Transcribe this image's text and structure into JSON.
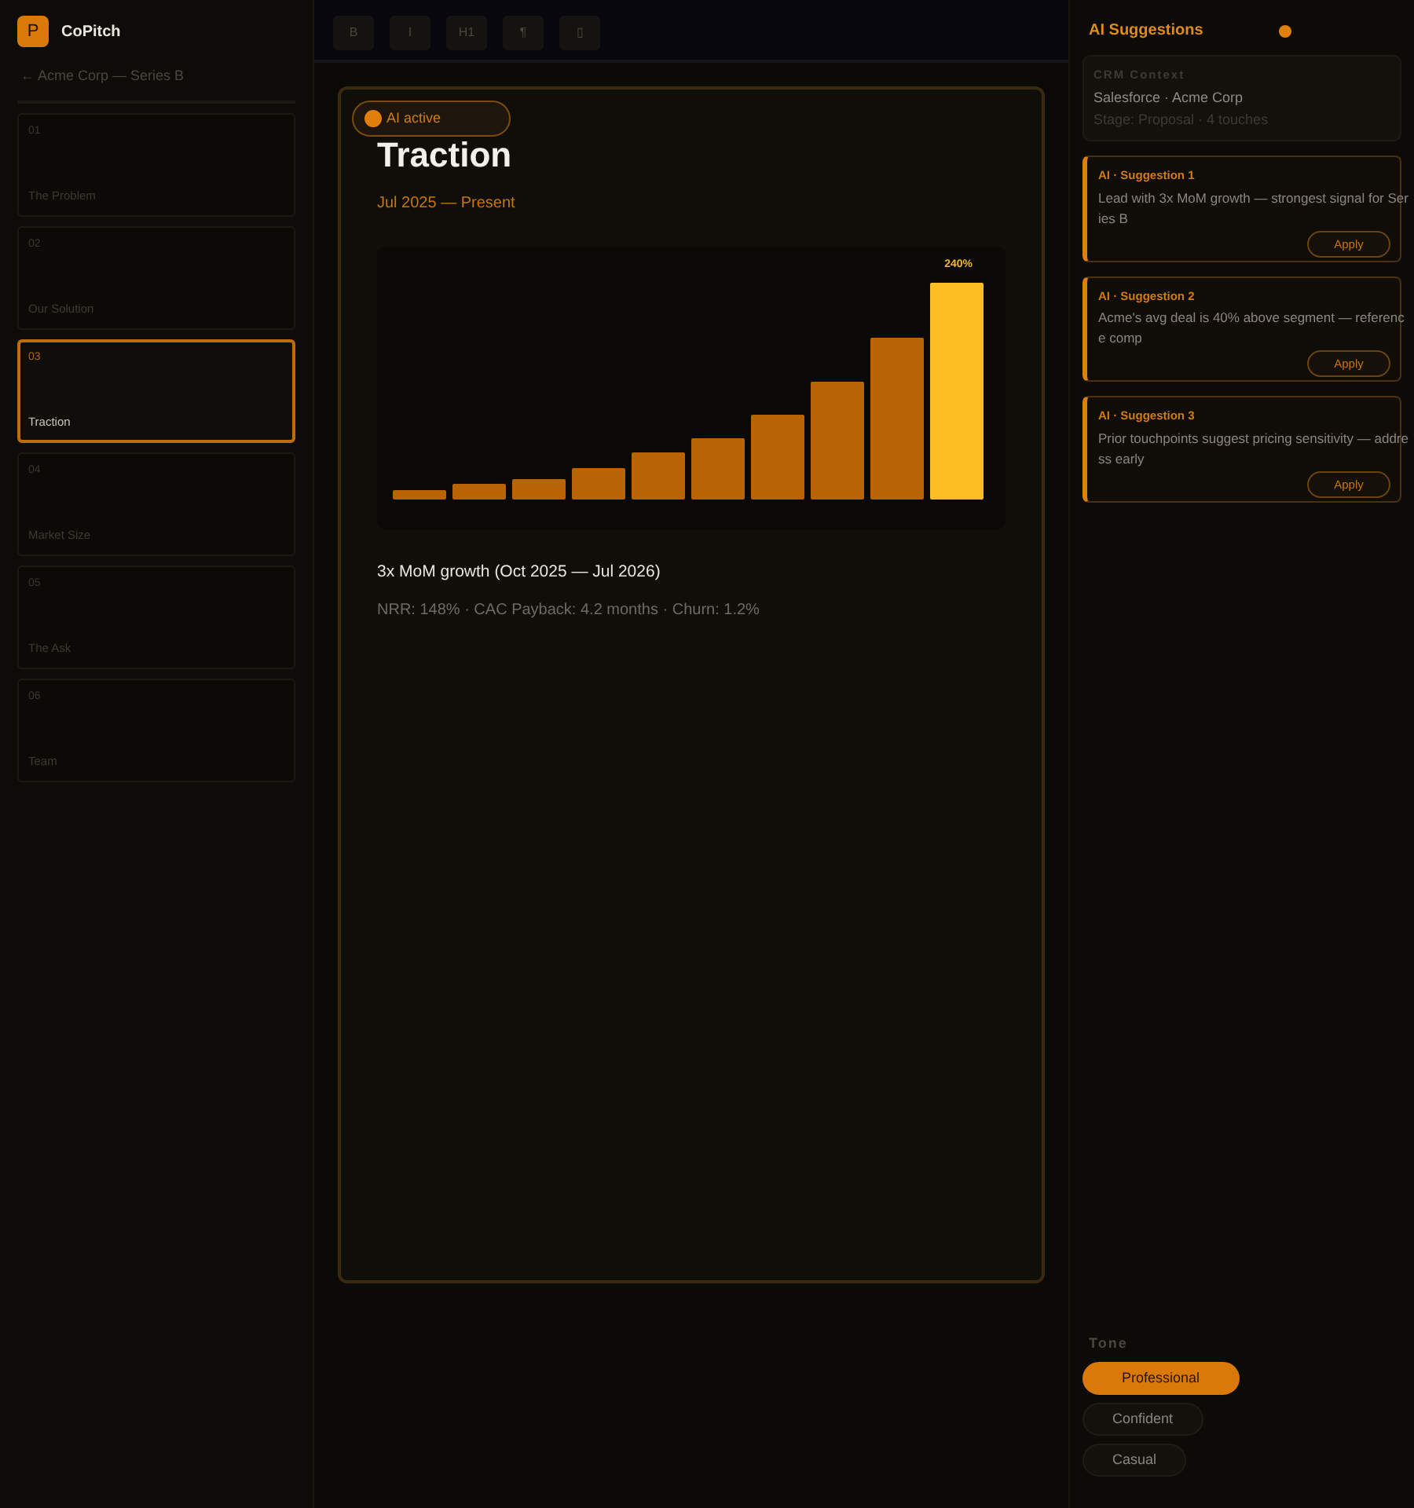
{
  "app": {
    "logo": "P",
    "name": "CoPitch",
    "back_link": "← Acme Corp — Series B"
  },
  "slides": [
    {
      "number": "01",
      "title": "The Problem",
      "selected": false
    },
    {
      "number": "02",
      "title": "Our Solution",
      "selected": false
    },
    {
      "number": "03",
      "title": "Traction",
      "selected": true
    },
    {
      "number": "04",
      "title": "Market Size",
      "selected": false
    },
    {
      "number": "05",
      "title": "The Ask",
      "selected": false
    },
    {
      "number": "06",
      "title": "Team",
      "selected": false
    }
  ],
  "toolbar": [
    "B",
    "I",
    "H1",
    "¶",
    "▯"
  ],
  "slide": {
    "ai_badge": "AI active",
    "title": "Traction",
    "subtitle": "Jul 2025 — Present",
    "chart": {
      "peak_label": "240%"
    },
    "headline": "3x MoM growth (Oct 2025 — Jul 2026)",
    "metrics": "NRR: 148% · CAC Payback: 4.2 months · Churn: 1.2%"
  },
  "panel": {
    "title": "AI Suggestions",
    "crm": {
      "heading": "CRM Context",
      "source": "Salesforce · Acme Corp",
      "stage": "Stage: Proposal · 4 touches"
    },
    "suggestions": [
      {
        "label": "AI · Suggestion 1",
        "text": "Lead with 3x MoM growth — strongest signal for Series B",
        "button": "Apply"
      },
      {
        "label": "AI · Suggestion 2",
        "text": "Acme's avg deal is 40% above segment — reference comp",
        "button": "Apply"
      },
      {
        "label": "AI · Suggestion 3",
        "text": "Prior touchpoints suggest pricing sensitivity — address early",
        "button": "Apply"
      }
    ],
    "tone": {
      "heading": "Tone",
      "options": [
        {
          "label": "Professional",
          "selected": true
        },
        {
          "label": "Confident",
          "selected": false
        },
        {
          "label": "Casual",
          "selected": false
        }
      ]
    }
  }
}
